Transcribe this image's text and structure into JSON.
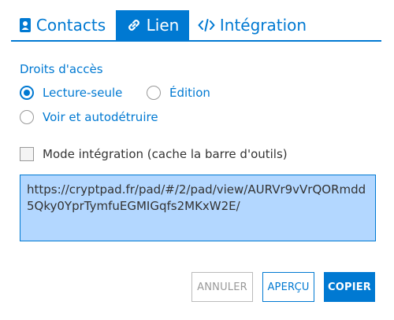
{
  "tabs": [
    {
      "label": "Contacts",
      "icon": "address-book-icon"
    },
    {
      "label": "Lien",
      "icon": "link-icon",
      "active": true
    },
    {
      "label": "Intégration",
      "icon": "code-icon"
    }
  ],
  "access": {
    "title": "Droits d'accès",
    "options": [
      {
        "label": "Lecture-seule",
        "checked": true
      },
      {
        "label": "Édition",
        "checked": false
      },
      {
        "label": "Voir et autodétruire",
        "checked": false
      }
    ]
  },
  "embed_mode": {
    "label": "Mode intégration (cache la barre d'outils)",
    "checked": false
  },
  "link": {
    "value": "https://cryptpad.fr/pad/#/2/pad/view/AURVr9vVrQORmdd5Qky0YprTymfuEGMIGqfs2MKxW2E/"
  },
  "buttons": {
    "cancel": "ANNULER",
    "preview": "APERÇU",
    "copy": "COPIER"
  },
  "colors": {
    "accent": "#0079d2",
    "selection": "#b3d7ff"
  }
}
